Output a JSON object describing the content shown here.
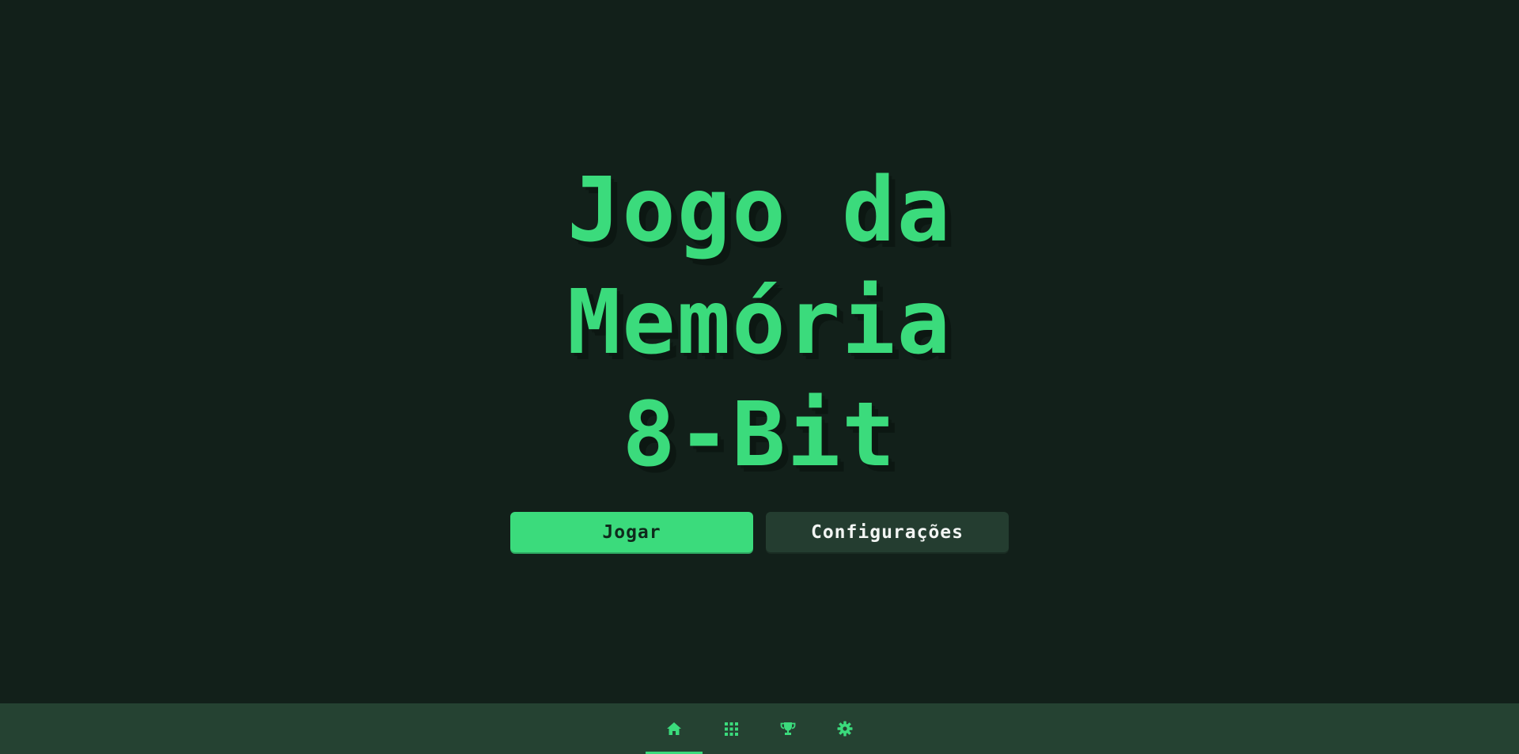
{
  "hero": {
    "title_lines": [
      "Jogo da",
      "Memória",
      "8-Bit"
    ]
  },
  "actions": {
    "play_label": "Jogar",
    "settings_label": "Configurações"
  },
  "nav": {
    "items": [
      {
        "icon": "home-icon",
        "active": true
      },
      {
        "icon": "grid-icon",
        "active": false
      },
      {
        "icon": "trophy-icon",
        "active": false
      },
      {
        "icon": "gear-icon",
        "active": false
      }
    ]
  },
  "colors": {
    "background": "#12201a",
    "accent": "#3bdb7c",
    "nav_background": "#254232",
    "secondary_button": "#243d30"
  }
}
